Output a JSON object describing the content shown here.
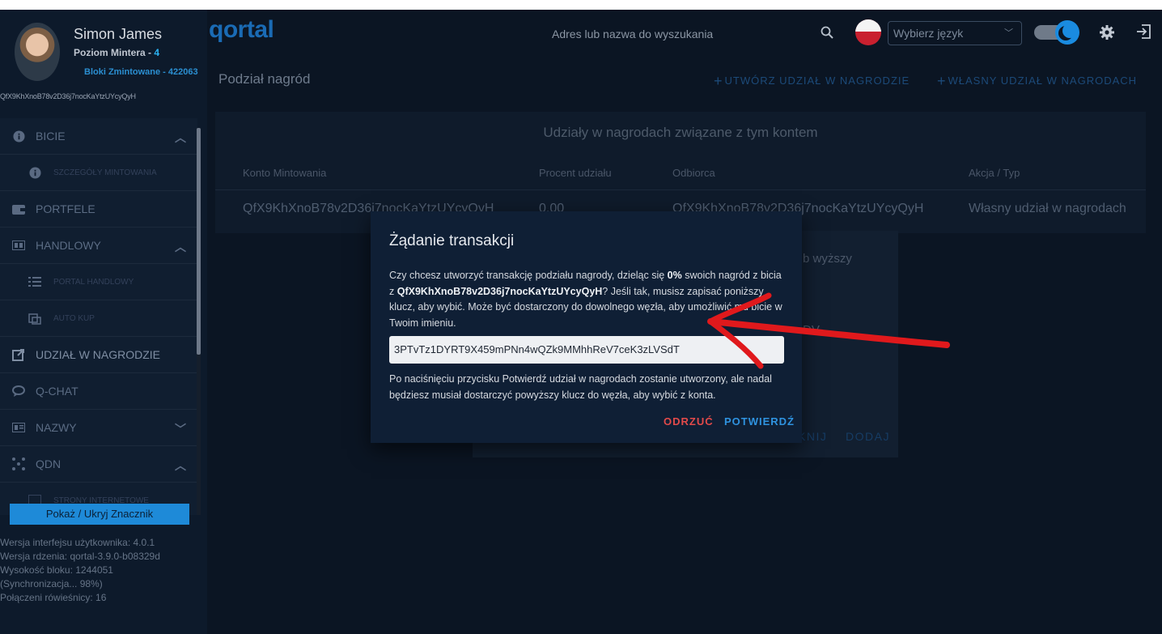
{
  "profile": {
    "name": "Simon James",
    "level_label": "Poziom Mintera - ",
    "level_value": "4",
    "blocks": "Bloki Zmintowane - 422063",
    "address": "QfX9KhXnoB78v2D36j7nocKaYtzUYcyQyH"
  },
  "sidebar": {
    "items": [
      {
        "label": "BICIE",
        "icon": "info-icon"
      },
      {
        "label": "SZCZEGÓŁY MINTOWANIA",
        "icon": "info-icon"
      },
      {
        "label": "PORTFELE",
        "icon": "wallet-icon"
      },
      {
        "label": "HANDLOWY",
        "icon": "trade-icon"
      },
      {
        "label": "PORTAL HANDLOWY",
        "icon": "list-icon"
      },
      {
        "label": "AUTO KUP",
        "icon": "bot-icon"
      },
      {
        "label": "UDZIAŁ W NAGRODZIE",
        "icon": "share-icon"
      },
      {
        "label": "Q-CHAT",
        "icon": "chat-icon"
      },
      {
        "label": "NAZWY",
        "icon": "badge-icon"
      },
      {
        "label": "QDN",
        "icon": "network-icon"
      },
      {
        "label": "STRONY INTERNETOWE",
        "icon": "web-icon"
      }
    ],
    "toggle_button": "Pokaż / Ukryj Znacznik",
    "versions": {
      "ui": "Wersja interfejsu użytkownika: 4.0.1",
      "core": "Wersja rdzenia: qortal-3.9.0-b08329d",
      "height": "Wysokość bloku: 1244051",
      "sync": "(Synchronizacja... 98%)",
      "peers": "Połączeni rówieśnicy: 16"
    }
  },
  "header": {
    "logo": "qortal",
    "search_placeholder": "Adres lub nazwa do wyszukania",
    "language_select": "Wybierz język"
  },
  "page": {
    "title": "Podział nagród",
    "create_button": "UTWÓRZ UDZIAŁ W NAGRODZIE",
    "own_button": "WŁASNY UDZIAŁ W NAGRODACH",
    "plus": "+",
    "card_title": "Udziały w nagrodach związane z tym kontem",
    "columns": [
      "Konto Mintowania",
      "Procent udziału",
      "Odbiorca",
      "Akcja / Typ"
    ],
    "row": {
      "account": "QfX9KhXnoB78v2D36j7nocKaYtzUYcyQyH",
      "percent": "0.00",
      "recipient": "QfX9KhXnoB78v2D36j7nocKaYtzUYcyQyH",
      "action": "Własny udział w nagrodach"
    }
  },
  "background_dialog": {
    "text1": "b wyższy",
    "text2": "DV",
    "cancel_fragment": "KNIJ",
    "add": "DODAJ"
  },
  "modal": {
    "title": "Żądanie transakcji",
    "body_1": "Czy chcesz utworzyć transakcję podziału nagrody, dzieląc się ",
    "percent": "0%",
    "body_2": " swoich nagród z bicia z ",
    "address": "QfX9KhXnoB78v2D36j7nocKaYtzUYcyQyH",
    "body_3": "? Jeśli tak, musisz zapisać poniższy klucz, aby wybić. Może być dostarczony do dowolnego węzła, aby umożliwić mu bicie w Twoim imieniu.",
    "key": "3PTvTz1DYRT9X459mPNn4wQZk9MMhhReV7ceK3zLVSdT",
    "note": "Po naciśnięciu przycisku Potwierdź udział w nagrodach zostanie utworzony, ale nadal będziesz musiał dostarczyć powyższy klucz do węzła, aby wybić z konta.",
    "reject": "ODRZUĆ",
    "confirm": "POTWIERDŹ"
  },
  "colors": {
    "background": "#0b1523",
    "accent": "#1e8ad8",
    "danger": "#e24a4a",
    "annotation": "#e0191c"
  }
}
